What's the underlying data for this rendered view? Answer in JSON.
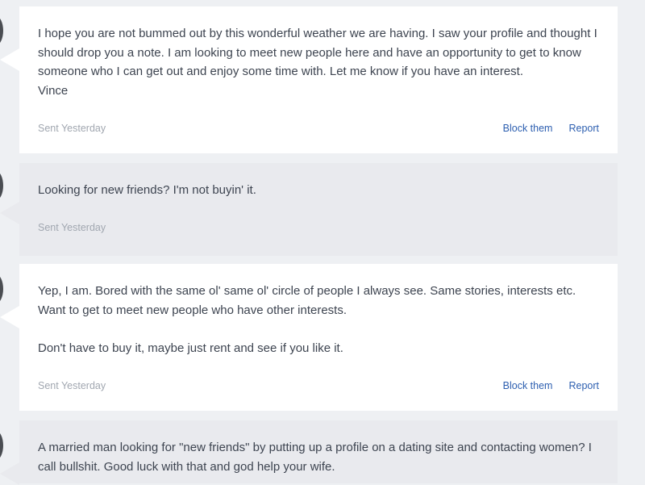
{
  "messages": [
    {
      "text": "I hope you are not bummed out by this wonderful weather we are having. I saw your profile and thought I should drop you a note. I am looking to meet new people here and have an opportunity to get to know someone who I can get out and enjoy some time with. Let me know if you have an interest.\nVince",
      "sent": "Sent Yesterday",
      "block_label": "Block them",
      "report_label": "Report"
    },
    {
      "text": "Looking for new friends? I'm not buyin' it.",
      "sent": "Sent Yesterday"
    },
    {
      "text": "Yep, I am. Bored with the same ol' same ol' circle of people I always see. Same stories, interests etc. Want to get to meet new people who have other interests.\n\nDon't have to buy it, maybe just rent and see if you like it.",
      "sent": "Sent Yesterday",
      "block_label": "Block them",
      "report_label": "Report"
    },
    {
      "text": "A married man looking for \"new friends\" by putting up a profile on a dating site and contacting women? I call bullshit. Good luck with that and god help your wife."
    }
  ],
  "colors": {
    "page_background": "#eef0f3",
    "received_bubble": "#ffffff",
    "sent_bubble": "#e9eaee",
    "link": "#2d5fb0",
    "timestamp": "#a1a7b0",
    "text": "#3d4450"
  }
}
